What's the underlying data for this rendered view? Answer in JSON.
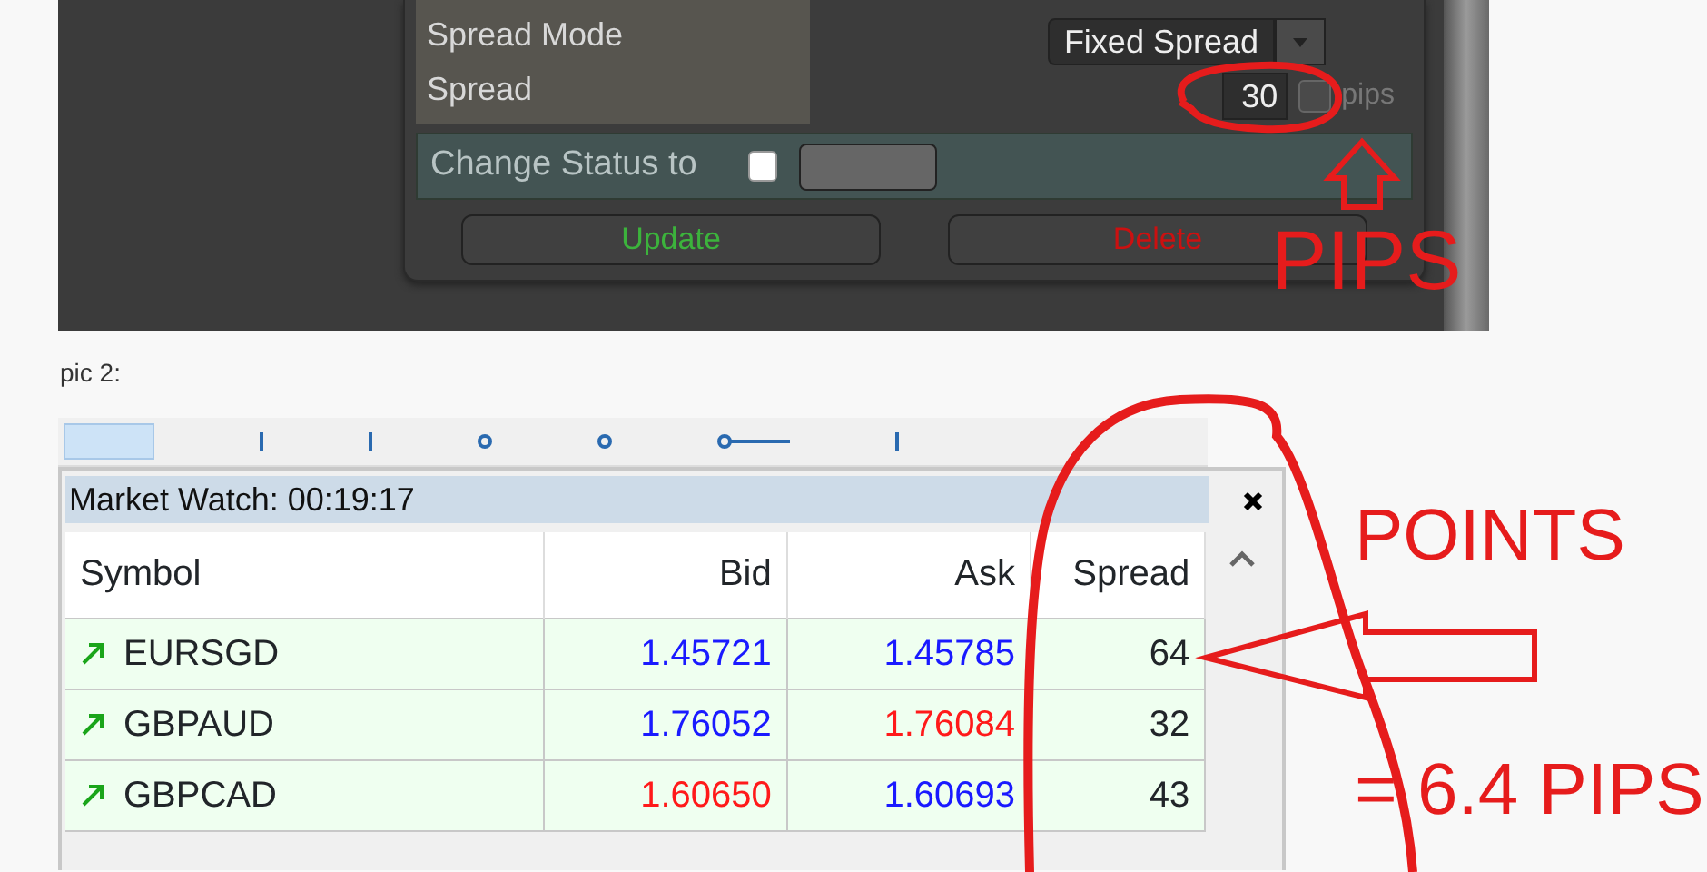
{
  "settings_dialog": {
    "labels": [
      "Spread Mode",
      "Spread"
    ],
    "spread_mode": "Fixed Spread",
    "spread": "30",
    "pips_checked": false,
    "pips_label": "pips",
    "status_label": "Change Status to",
    "status_checked": false,
    "buttons": [
      {
        "label": "Update",
        "kind": "update"
      },
      {
        "label": "Delete",
        "kind": "delete"
      }
    ]
  },
  "caption": "pic 2:",
  "market_watch": {
    "title": "Market Watch: 00:19:17",
    "columns": [
      "Symbol",
      "Bid",
      "Ask",
      "Spread"
    ],
    "rows": [
      {
        "rising": true,
        "symbol": "EURSGD",
        "bid": {
          "text": "1.45721",
          "color": "#1a1aff"
        },
        "ask": {
          "text": "1.45785",
          "color": "#1a1aff"
        },
        "spread": "64"
      },
      {
        "rising": true,
        "symbol": "GBPAUD",
        "bid": {
          "text": "1.76052",
          "color": "#1a1aff"
        },
        "ask": {
          "text": "1.76084",
          "color": "#ff1a1a"
        },
        "spread": "32"
      },
      {
        "rising": true,
        "symbol": "GBPCAD",
        "bid": {
          "text": "1.60650",
          "color": "#ff1a1a"
        },
        "ask": {
          "text": "1.60693",
          "color": "#1a1aff"
        },
        "spread": "43"
      }
    ]
  },
  "annotations": [
    "PIPS",
    "POINTS",
    "= 6.4 PIPS"
  ]
}
